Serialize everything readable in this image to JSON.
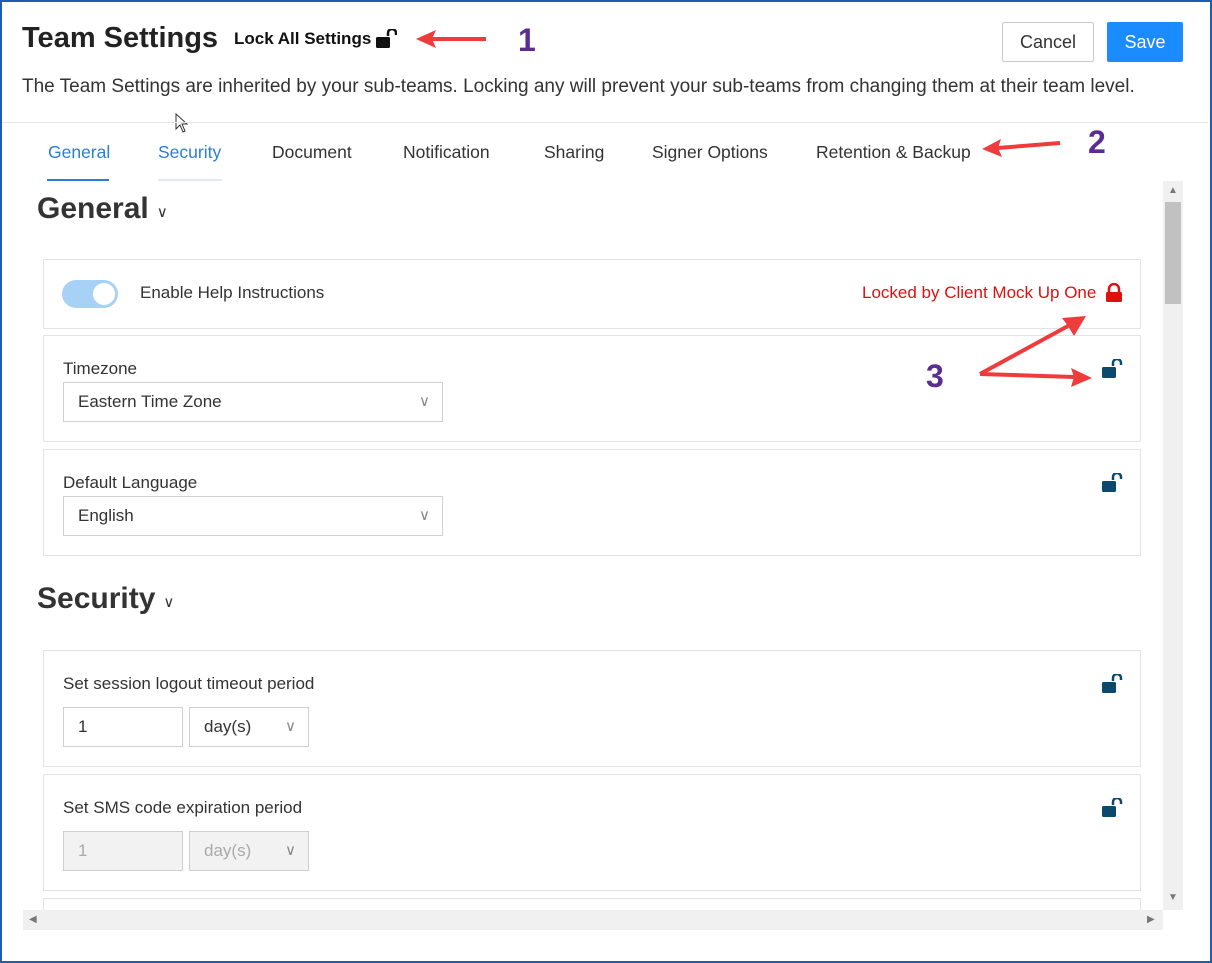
{
  "header": {
    "title": "Team Settings",
    "lock_all_label": "Lock All Settings",
    "cancel_label": "Cancel",
    "save_label": "Save",
    "description": "The Team Settings are inherited by your sub-teams. Locking any will prevent your sub-teams from changing them at their team level."
  },
  "annotations": {
    "n1": "1",
    "n2": "2",
    "n3": "3"
  },
  "tabs": [
    {
      "label": "General"
    },
    {
      "label": "Security"
    },
    {
      "label": "Document"
    },
    {
      "label": "Notification"
    },
    {
      "label": "Sharing"
    },
    {
      "label": "Signer Options"
    },
    {
      "label": "Retention & Backup"
    }
  ],
  "general": {
    "heading": "General",
    "help": {
      "label": "Enable Help Instructions",
      "locked_text": "Locked by Client Mock Up One",
      "enabled": true
    },
    "timezone": {
      "label": "Timezone",
      "value": "Eastern Time Zone"
    },
    "language": {
      "label": "Default Language",
      "value": "English"
    }
  },
  "security": {
    "heading": "Security",
    "session": {
      "label": "Set session logout timeout period",
      "value": "1",
      "unit": "day(s)"
    },
    "sms": {
      "label": "Set SMS code expiration period",
      "value": "1",
      "unit": "day(s)"
    }
  },
  "colors": {
    "accent": "#1a8cff",
    "locked": "#dd1111",
    "lock_icon": "#0b4a6e",
    "annotation_arrow": "#ef3b3b",
    "annotation_number": "#5c2d91"
  },
  "icons": {
    "lock_all": "unlocked-padlock-icon",
    "locked": "locked-padlock-icon",
    "unlocked": "unlocked-padlock-icon"
  }
}
